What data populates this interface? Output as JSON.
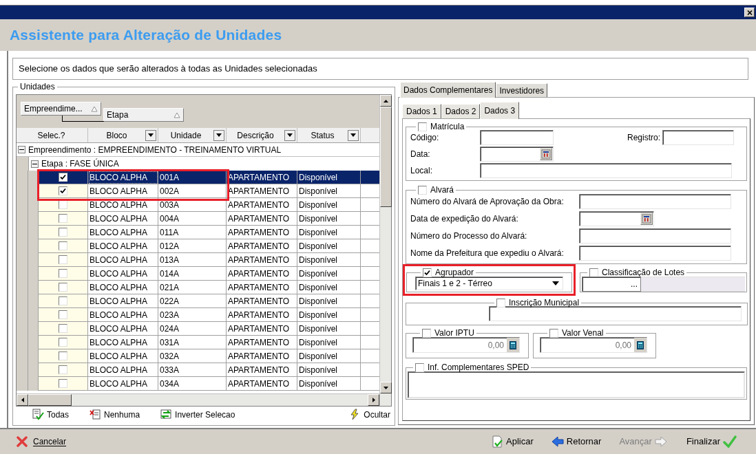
{
  "window": {
    "title": "Assistente para Alteração de Unidades"
  },
  "instruction": "Selecione os dados que serão alterados à todas as Unidades selecionadas",
  "units_panel": {
    "title": "Unidades",
    "group_by": [
      {
        "label": "Empreendime..."
      },
      {
        "label": "Etapa"
      }
    ],
    "columns": [
      {
        "label": "Selec.?",
        "filter": false
      },
      {
        "label": "Bloco",
        "filter": true
      },
      {
        "label": "Unidade",
        "filter": true
      },
      {
        "label": "Descrição",
        "filter": true
      },
      {
        "label": "Status",
        "filter": true
      }
    ],
    "groups": [
      {
        "label": "Empreendimento : EMPREENDIMENTO - TREINAMENTO VIRTUAL",
        "expanded": true,
        "children": [
          {
            "label": "Etapa : FASE ÚNICA",
            "expanded": true,
            "rows": [
              {
                "checked": true,
                "selected": true,
                "highlighted": true,
                "cells": [
                  "BLOCO ALPHA",
                  "001A",
                  "APARTAMENTO",
                  "Disponível"
                ]
              },
              {
                "checked": true,
                "selected": false,
                "highlighted": true,
                "cells": [
                  "BLOCO ALPHA",
                  "002A",
                  "APARTAMENTO",
                  "Disponível"
                ]
              },
              {
                "checked": false,
                "selected": false,
                "highlighted": false,
                "cells": [
                  "BLOCO ALPHA",
                  "003A",
                  "APARTAMENTO",
                  "Disponível"
                ]
              },
              {
                "checked": false,
                "selected": false,
                "highlighted": false,
                "cells": [
                  "BLOCO ALPHA",
                  "004A",
                  "APARTAMENTO",
                  "Disponível"
                ]
              },
              {
                "checked": false,
                "selected": false,
                "highlighted": false,
                "cells": [
                  "BLOCO ALPHA",
                  "011A",
                  "APARTAMENTO",
                  "Disponível"
                ]
              },
              {
                "checked": false,
                "selected": false,
                "highlighted": false,
                "cells": [
                  "BLOCO ALPHA",
                  "012A",
                  "APARTAMENTO",
                  "Disponível"
                ]
              },
              {
                "checked": false,
                "selected": false,
                "highlighted": false,
                "cells": [
                  "BLOCO ALPHA",
                  "013A",
                  "APARTAMENTO",
                  "Disponível"
                ]
              },
              {
                "checked": false,
                "selected": false,
                "highlighted": false,
                "cells": [
                  "BLOCO ALPHA",
                  "014A",
                  "APARTAMENTO",
                  "Disponível"
                ]
              },
              {
                "checked": false,
                "selected": false,
                "highlighted": false,
                "cells": [
                  "BLOCO ALPHA",
                  "021A",
                  "APARTAMENTO",
                  "Disponível"
                ]
              },
              {
                "checked": false,
                "selected": false,
                "highlighted": false,
                "cells": [
                  "BLOCO ALPHA",
                  "022A",
                  "APARTAMENTO",
                  "Disponível"
                ]
              },
              {
                "checked": false,
                "selected": false,
                "highlighted": false,
                "cells": [
                  "BLOCO ALPHA",
                  "023A",
                  "APARTAMENTO",
                  "Disponível"
                ]
              },
              {
                "checked": false,
                "selected": false,
                "highlighted": false,
                "cells": [
                  "BLOCO ALPHA",
                  "024A",
                  "APARTAMENTO",
                  "Disponível"
                ]
              },
              {
                "checked": false,
                "selected": false,
                "highlighted": false,
                "cells": [
                  "BLOCO ALPHA",
                  "031A",
                  "APARTAMENTO",
                  "Disponível"
                ]
              },
              {
                "checked": false,
                "selected": false,
                "highlighted": false,
                "cells": [
                  "BLOCO ALPHA",
                  "032A",
                  "APARTAMENTO",
                  "Disponível"
                ]
              },
              {
                "checked": false,
                "selected": false,
                "highlighted": false,
                "cells": [
                  "BLOCO ALPHA",
                  "033A",
                  "APARTAMENTO",
                  "Disponível"
                ]
              },
              {
                "checked": false,
                "selected": false,
                "highlighted": false,
                "cells": [
                  "BLOCO ALPHA",
                  "034A",
                  "APARTAMENTO",
                  "Disponível"
                ]
              }
            ]
          }
        ]
      }
    ],
    "actions": [
      {
        "label": "Todas",
        "kind": "all"
      },
      {
        "label": "Nenhuma",
        "kind": "none"
      },
      {
        "label": "Inverter Selecao",
        "kind": "invert"
      },
      {
        "label": "Ocultar",
        "kind": "hide"
      }
    ]
  },
  "tabs": [
    {
      "label": "Dados Complementares",
      "selected": true
    },
    {
      "label": "Investidores",
      "selected": false
    }
  ],
  "subtabs": [
    {
      "label": "Dados 1",
      "selected": false
    },
    {
      "label": "Dados 2",
      "selected": false
    },
    {
      "label": "Dados 3",
      "selected": true
    }
  ],
  "matricula": {
    "label": "Matrícula",
    "checked": false,
    "codigo": "Código:",
    "registro": "Registro:",
    "data": "Data:",
    "local": "Local:"
  },
  "alvara": {
    "label": "Alvará",
    "checked": false,
    "fields": [
      {
        "label": "Número do Alvará de Aprovação da Obra:",
        "kind": "text"
      },
      {
        "label": "Data de expedição do Alvará:",
        "kind": "date"
      },
      {
        "label": "Número do Processo do Alvará:",
        "kind": "text"
      },
      {
        "label": "Nome da Prefeitura que expediu o Alvará:",
        "kind": "text"
      }
    ]
  },
  "agrupador": {
    "label": "Agrupador",
    "checked": true,
    "highlighted": true,
    "value": "Finais 1 e 2 - Térreo"
  },
  "classificacao_lotes": {
    "label": "Classificação de Lotes",
    "checked": false,
    "button": "..."
  },
  "inscricao_municipal": {
    "label": "Inscrição Municipal",
    "checked": false
  },
  "valores": [
    {
      "label": "Valor IPTU",
      "checked": false,
      "value": "0,00"
    },
    {
      "label": "Valor Venal",
      "checked": false,
      "value": "0,00"
    }
  ],
  "sped": {
    "label": "Inf. Complementares SPED",
    "checked": false
  },
  "footer": {
    "cancel": "Cancelar",
    "buttons": [
      {
        "label": "Aplicar",
        "kind": "apply",
        "disabled": false
      },
      {
        "label": "Retornar",
        "kind": "back",
        "disabled": false
      },
      {
        "label": "Avançar",
        "kind": "next",
        "disabled": true
      },
      {
        "label": "Finalizar",
        "kind": "finish",
        "disabled": false
      }
    ]
  }
}
